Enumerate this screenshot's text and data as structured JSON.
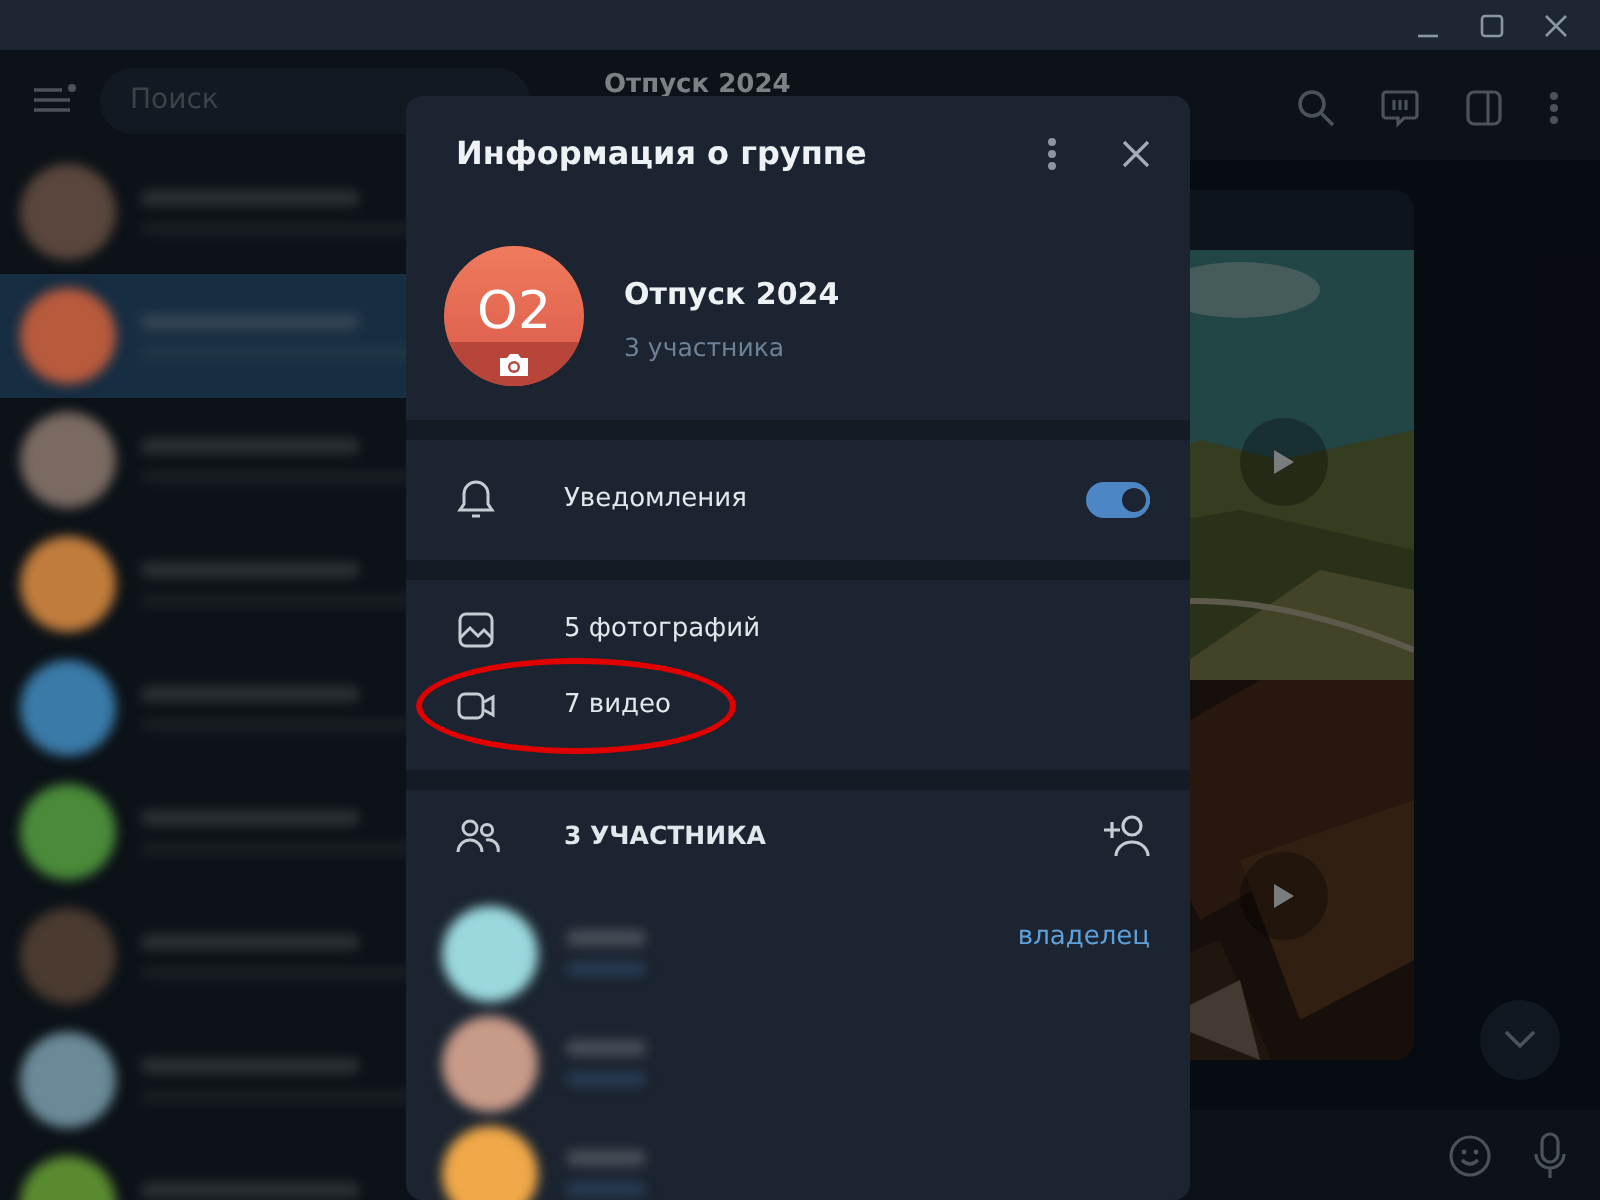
{
  "sidebar": {
    "search": {
      "placeholder": "Поиск"
    }
  },
  "chats": [
    {
      "color": "#5a463c",
      "selected": false
    },
    {
      "color": "#b85a3c",
      "selected": true
    },
    {
      "color": "#7a6a62",
      "selected": false
    },
    {
      "color": "#c07c3c",
      "selected": false
    },
    {
      "color": "#3a7aa8",
      "selected": false
    },
    {
      "color": "#4a8a3a",
      "selected": false
    },
    {
      "color": "#4a3a30",
      "selected": false
    },
    {
      "color": "#6a8a98",
      "selected": false
    },
    {
      "color": "#5a8a30",
      "selected": false
    }
  ],
  "chat": {
    "title": "Отпуск 2024",
    "media": [
      {
        "kind": "video"
      },
      {
        "kind": "video"
      }
    ]
  },
  "dialog": {
    "title": "Информация о группе",
    "group": {
      "avatar_text": "О2",
      "name": "Отпуск 2024",
      "subtitle": "3 участника"
    },
    "notifications": {
      "label": "Уведомления",
      "on": true
    },
    "media": [
      {
        "label": "5 фотографий",
        "highlighted": false
      },
      {
        "kind": "video",
        "label": "7 видео",
        "highlighted": true
      }
    ],
    "members": {
      "title": "3 УЧАСТНИКА",
      "items": [
        {
          "color": "#9ad8de",
          "role": "владелец"
        },
        {
          "color": "#c89a88"
        },
        {
          "color": "#f0a848"
        }
      ]
    }
  }
}
